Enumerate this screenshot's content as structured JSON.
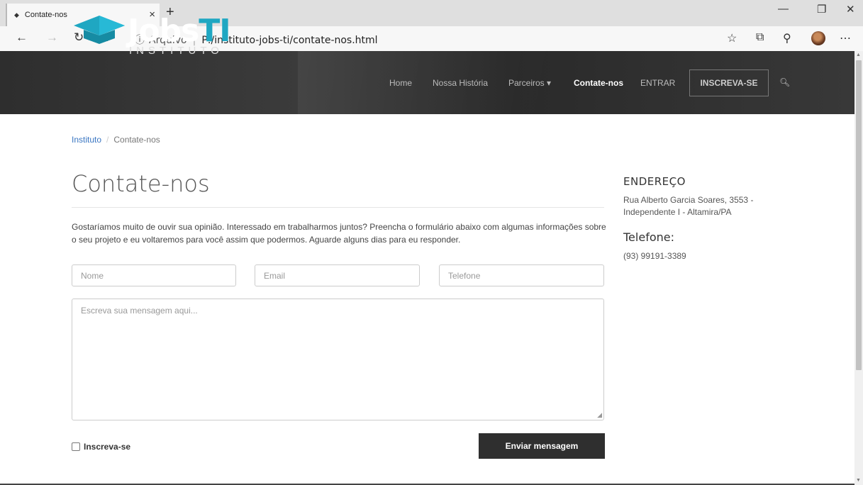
{
  "browser": {
    "tab_title": "Contate-nos",
    "tab_close": "×",
    "new_tab": "+",
    "address_label": "Arquivo",
    "address_url": "P:/instituto-jobs-ti/contate-nos.html",
    "icons": [
      "back-arrow-icon",
      "forward-arrow-icon",
      "refresh-icon",
      "home-icon",
      "info-icon",
      "star-icon",
      "collections-icon",
      "read-aloud-icon",
      "profile-avatar",
      "more-icon",
      "minimize-icon",
      "restore-icon",
      "close-icon"
    ]
  },
  "header": {
    "logo_main": "Jobs",
    "logo_accent": "TI",
    "logo_sub": "INSTITUTO",
    "menu": [
      {
        "label": "Home"
      },
      {
        "label": "Nossa História"
      },
      {
        "label": "Parceiros ▾"
      },
      {
        "label": "Contate-nos"
      },
      {
        "label": "ENTRAR"
      }
    ],
    "cta": "INSCREVA-SE",
    "accent_color": "#1fa7c2"
  },
  "breadcrumb": {
    "home": "Instituto",
    "separator": "/",
    "current": "Contate-nos"
  },
  "main": {
    "title": "Contate-nos",
    "intro": "Gostaríamos muito de ouvir sua opinião. Interessado em trabalharmos juntos? Preencha o formulário abaixo com algumas informações sobre o seu projeto e eu voltaremos para você assim que podermos. Aguarde alguns dias para eu responder.",
    "form": {
      "name_placeholder": "Nome",
      "email_placeholder": "Email",
      "phone_placeholder": "Telefone",
      "message_placeholder": "Escreva sua mensagem aqui...",
      "subscribe_label": "Inscreva-se",
      "submit_label": "Enviar mensagem"
    }
  },
  "sidebar": {
    "address_heading": "ENDEREÇO",
    "address_line1": "Rua Alberto Garcia Soares, 3553 -",
    "address_line2": "Independente I - Altamira/PA",
    "phone_heading": "Telefone:",
    "phone": "(93) 99191-3389"
  }
}
